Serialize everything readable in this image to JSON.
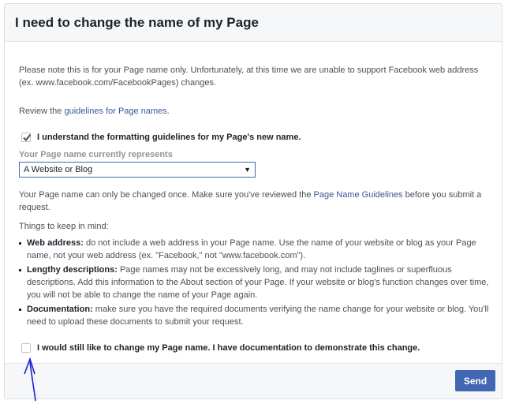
{
  "dialog": {
    "title": "I need to change the name of my Page",
    "note": "Please note this is for your Page name only. Unfortunately, at this time we are unable to support Facebook web address (ex. www.facebook.com/FacebookPages) changes.",
    "review_prefix": "Review the ",
    "review_link": "guidelines for Page names",
    "review_suffix": ".",
    "understand_checkbox": {
      "label": "I understand the formatting guidelines for my Page's new name.",
      "checked": true
    },
    "select_label": "Your Page name currently represents",
    "select_value": "A Website or Blog",
    "once_prefix": "Your Page name can only be changed once. Make sure you've reviewed the ",
    "once_link": "Page Name Guidelines",
    "once_suffix": " before you submit a request.",
    "things_heading": "Things to keep in mind:",
    "tips": [
      {
        "term": "Web address:",
        "text": " do not include a web address in your Page name. Use the name of your website or blog as your Page name, not your web address (ex. \"Facebook,\" not \"www.facebook.com\")."
      },
      {
        "term": "Lengthy descriptions:",
        "text": " Page names may not be excessively long, and may not include taglines or superfluous descriptions. Add this information to the About section of your Page. If your website or blog's function changes over time, you will not be able to change the name of your Page again."
      },
      {
        "term": "Documentation:",
        "text": " make sure you have the required documents verifying the name change for your website or blog. You'll need to upload these documents to submit your request."
      }
    ],
    "still_checkbox": {
      "label": "I would still like to change my Page name. I have documentation to demonstrate this change.",
      "checked": false
    },
    "send_label": "Send"
  },
  "colors": {
    "primary": "#4267b2",
    "link": "#365899",
    "annotation_arrow": "#1a22d8"
  }
}
